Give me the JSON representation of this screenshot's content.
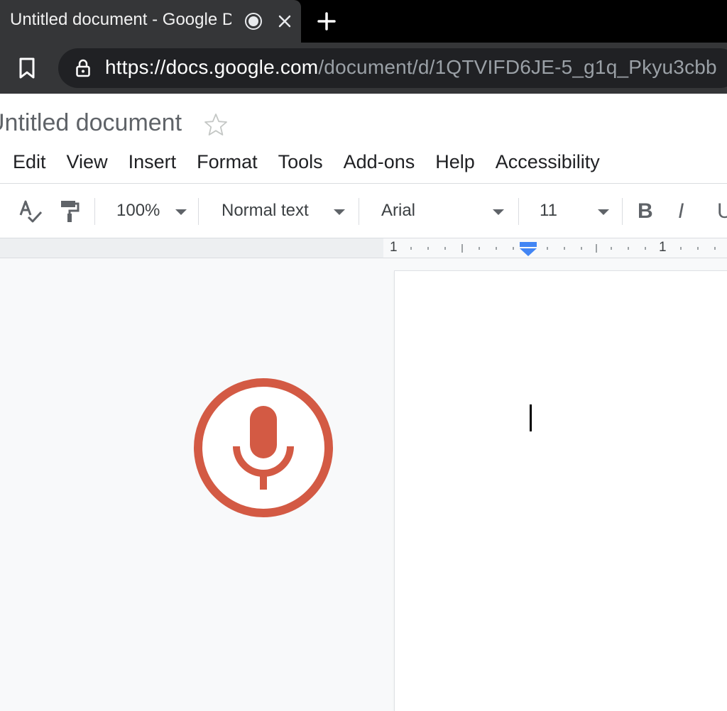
{
  "browser": {
    "tab_title": "Untitled document - Google Docs",
    "url_host": "https://docs.google.com",
    "url_path": "/document/d/1QTVIFD6JE-5_g1q_Pkyu3cbb"
  },
  "docs": {
    "title": "Untitled document",
    "menu": [
      "Edit",
      "View",
      "Insert",
      "Format",
      "Tools",
      "Add-ons",
      "Help",
      "Accessibility"
    ]
  },
  "toolbar": {
    "zoom": "100%",
    "style": "Normal text",
    "font": "Arial",
    "font_size": "11",
    "bold_label": "B",
    "italic_label": "I",
    "underline_label": "U"
  },
  "ruler": {
    "left_number": "1",
    "right_number": "1"
  },
  "colors": {
    "mic_accent": "#d35a44",
    "ruler_marker": "#4285f4"
  },
  "icons": {
    "spellcheck": "spellcheck-icon",
    "paint_format": "paint-format-icon",
    "voice_typing": "microphone-icon"
  }
}
